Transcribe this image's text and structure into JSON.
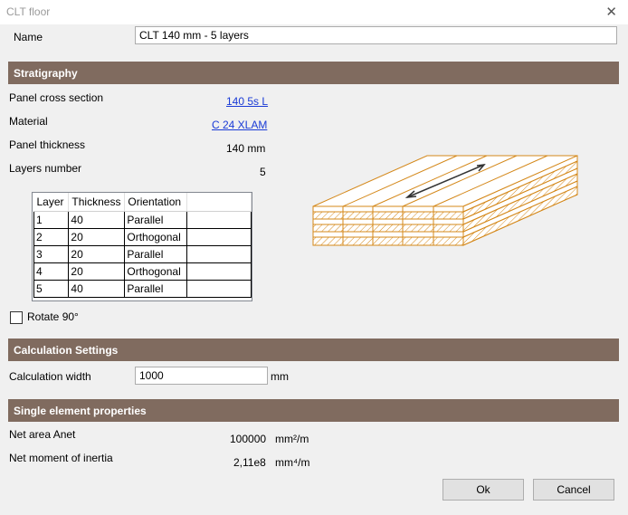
{
  "window": {
    "title": "CLT floor"
  },
  "name_field": {
    "label": "Name",
    "value": "CLT 140 mm - 5 layers"
  },
  "stratigraphy": {
    "header": "Stratigraphy",
    "panel_cross_section": {
      "label": "Panel cross section",
      "value": "140 5s L"
    },
    "material": {
      "label": "Material",
      "value": "C 24 XLAM"
    },
    "panel_thickness": {
      "label": "Panel thickness",
      "value": "140 mm"
    },
    "layers_number": {
      "label": "Layers number",
      "value": "5"
    },
    "table": {
      "columns": [
        "Layer",
        "Thickness",
        "Orientation"
      ],
      "rows": [
        [
          "1",
          "40",
          "Parallel"
        ],
        [
          "2",
          "20",
          "Orthogonal"
        ],
        [
          "3",
          "20",
          "Parallel"
        ],
        [
          "4",
          "20",
          "Orthogonal"
        ],
        [
          "5",
          "40",
          "Parallel"
        ]
      ]
    },
    "rotate": {
      "label": "Rotate 90°",
      "checked": false
    }
  },
  "calculation": {
    "header": "Calculation Settings",
    "width": {
      "label": "Calculation width",
      "value": "1000",
      "unit": "mm"
    }
  },
  "single_element": {
    "header": "Single element properties",
    "net_area": {
      "label": "Net area Anet",
      "value": "100000",
      "unit": "mm²/m"
    },
    "inertia": {
      "label": "Net moment of inertia",
      "value": "2,11e8",
      "unit": "mm⁴/m"
    }
  },
  "buttons": {
    "ok": "Ok",
    "cancel": "Cancel"
  },
  "colors": {
    "section_header": "#806b5f",
    "diagram_line": "#d4881a",
    "link": "#1a3bd6"
  },
  "icons": {
    "close": "close-icon",
    "diagram": "clt-panel-diagram"
  }
}
